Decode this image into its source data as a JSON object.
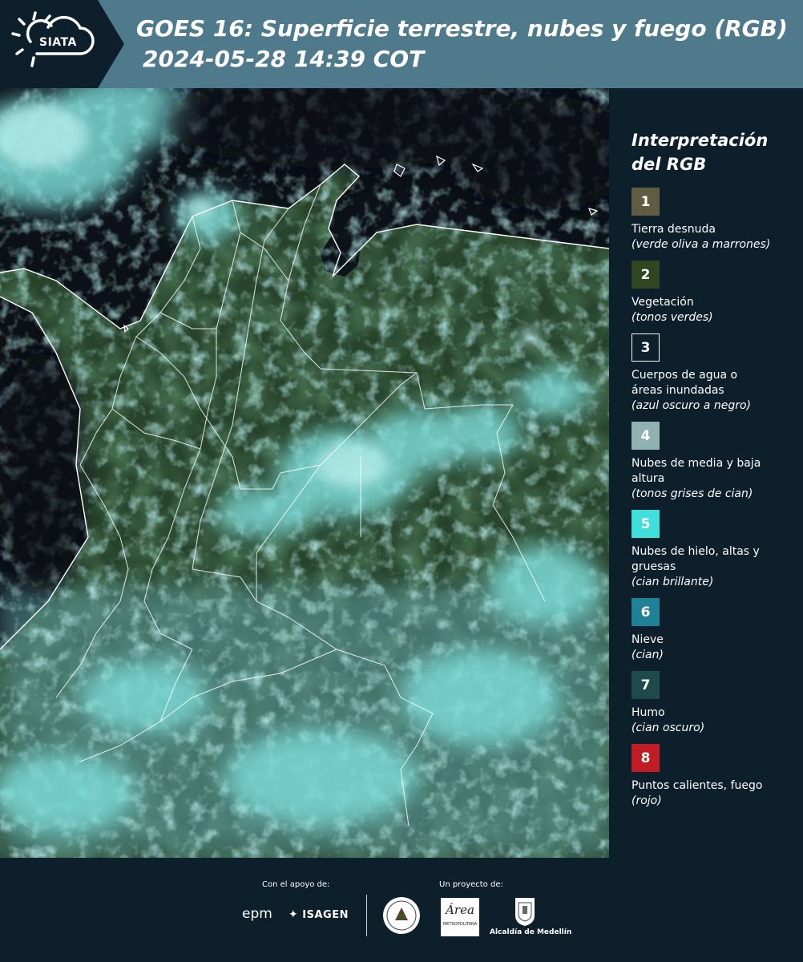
{
  "header": {
    "logo_text": "SIATA",
    "title": "GOES 16: Superficie terrestre, nubes y fuego (RGB)",
    "datetime": "2024-05-28 14:39 COT"
  },
  "legend": {
    "title_line1": "Interpretación",
    "title_line2": "del RGB",
    "items": [
      {
        "number": "1",
        "color": "#5e5d42",
        "label": "Tierra desnuda",
        "note": "(verde oliva a marrones)"
      },
      {
        "number": "2",
        "color": "#2f4620",
        "label": "Vegetación",
        "note": "(tonos verdes)"
      },
      {
        "number": "3",
        "color": "#0c1f2b",
        "label": "Cuerpos de agua o áreas inundadas",
        "note": "(azul oscuro a negro)"
      },
      {
        "number": "4",
        "color": "#8fb2b0",
        "label": "Nubes de media y baja altura",
        "note": "(tonos grises de cian)"
      },
      {
        "number": "5",
        "color": "#3fe0dc",
        "label": "Nubes de hielo, altas y gruesas",
        "note": "(cian brillante)"
      },
      {
        "number": "6",
        "color": "#1f8196",
        "label": "Nieve",
        "note": "(cian)"
      },
      {
        "number": "7",
        "color": "#1f4a4c",
        "label": "Humo",
        "note": "(cian oscuro)"
      },
      {
        "number": "8",
        "color": "#c21d24",
        "label": "Puntos calientes, fuego",
        "note": "(rojo)"
      }
    ]
  },
  "footer": {
    "support_label": "Con el apoyo de:",
    "project_label": "Un proyecto de:",
    "sponsor1": "epm",
    "sponsor2": "ISAGEN",
    "area_logo_text": "Área",
    "area_logo_sub": "METROPOLITANA",
    "alcaldia": "Alcaldía de Medellín"
  }
}
